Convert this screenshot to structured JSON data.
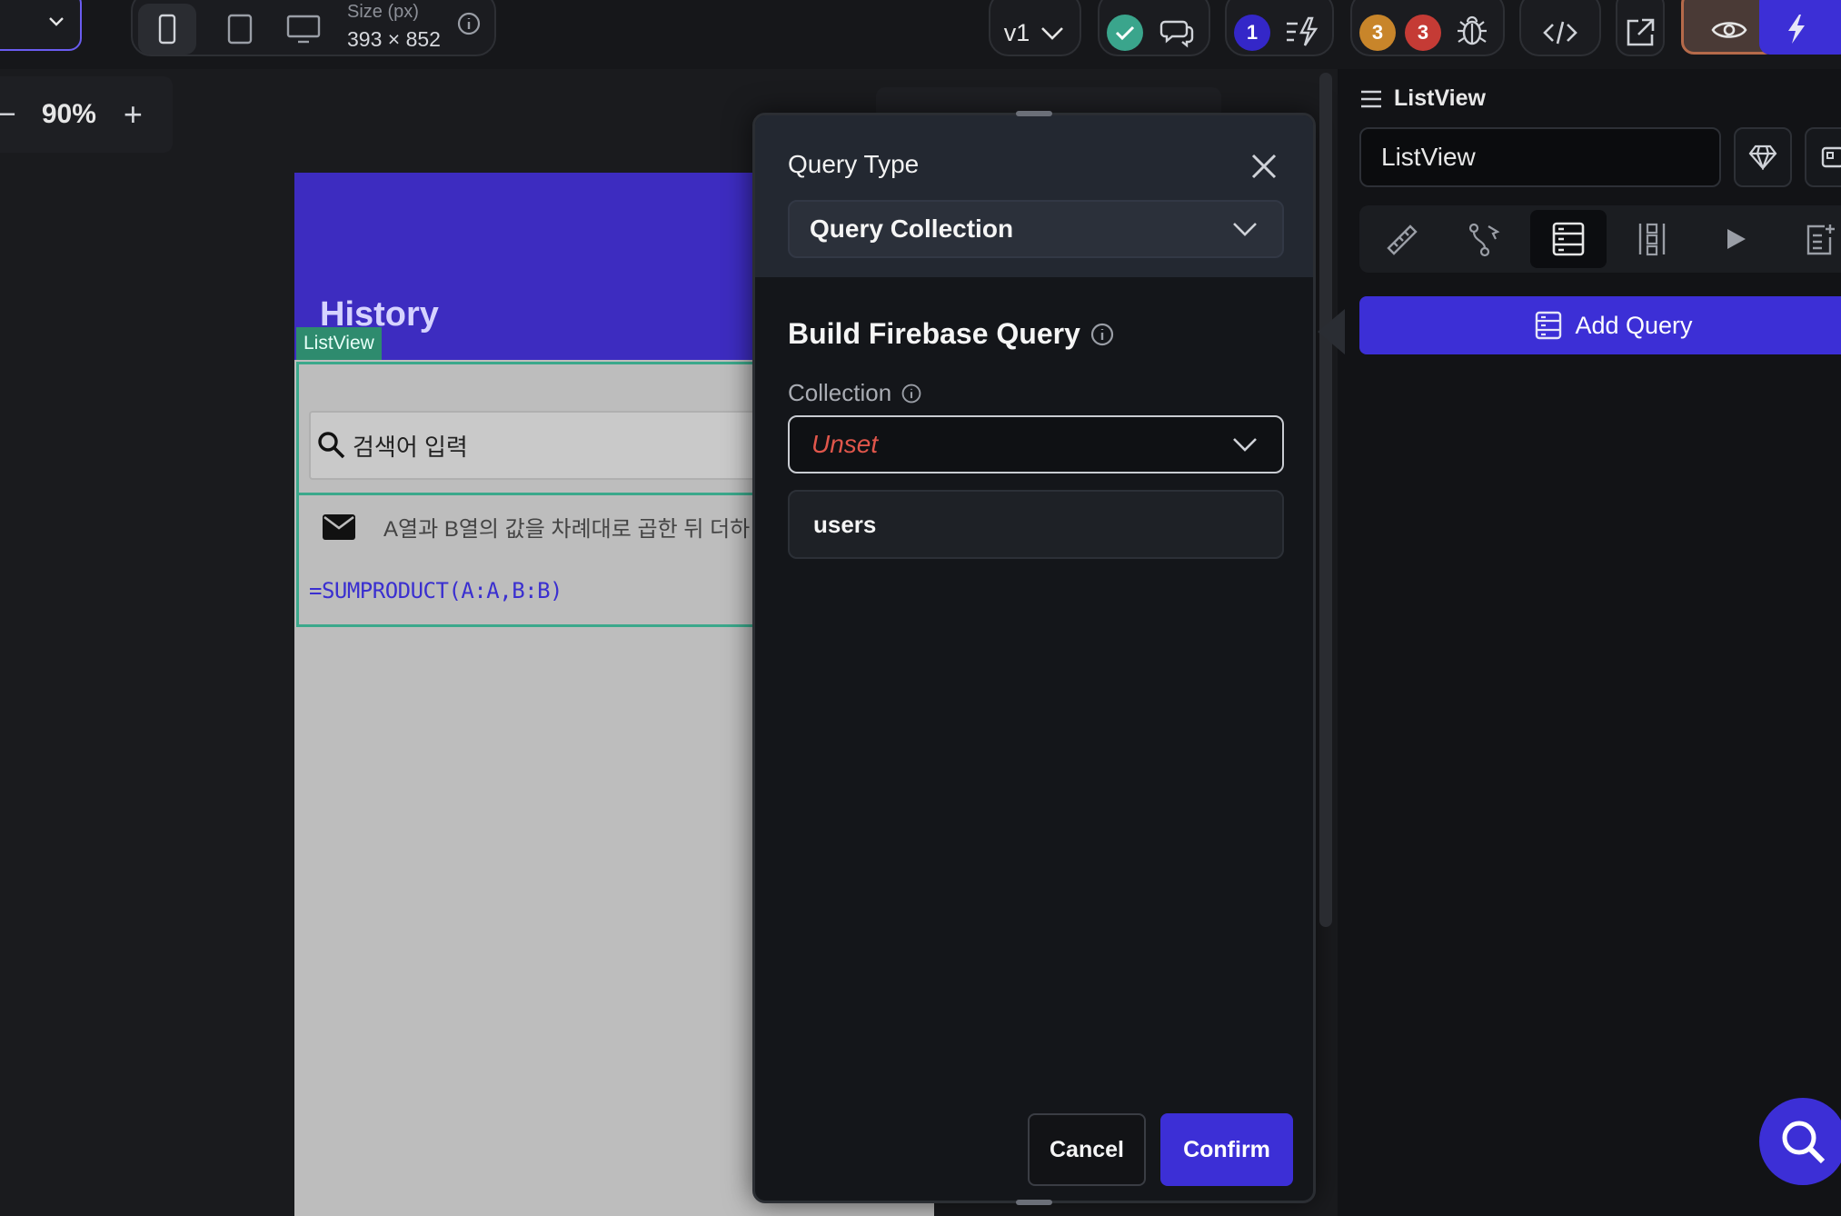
{
  "toolbar": {
    "size_label": "Size (px)",
    "size_value": "393 × 852",
    "version": "v1",
    "badge_blue": "1",
    "badge_orange": "3",
    "badge_red": "3"
  },
  "canvas": {
    "zoom": "90%",
    "zoom_minus": "−",
    "zoom_plus": "+"
  },
  "device": {
    "title": "History",
    "listview_tag": "ListView",
    "search_placeholder": "검색어 입력",
    "row_text": "A열과 B열의 값을 차례대로 곱한 뒤 더하",
    "formula": "=SUMPRODUCT(A:A,B:B)"
  },
  "dialog": {
    "query_type_label": "Query Type",
    "query_type_value": "Query Collection",
    "build_title": "Build Firebase Query",
    "collection_label": "Collection",
    "collection_value": "Unset",
    "options": [
      "users"
    ],
    "cancel": "Cancel",
    "confirm": "Confirm"
  },
  "panel": {
    "title": "ListView",
    "name_value": "ListView",
    "add_query": "Add Query"
  },
  "colors": {
    "accent": "#3c2fd6",
    "device_header": "#3d2cc0",
    "listview_green": "#3ba88b",
    "unset_red": "#e0564b"
  }
}
